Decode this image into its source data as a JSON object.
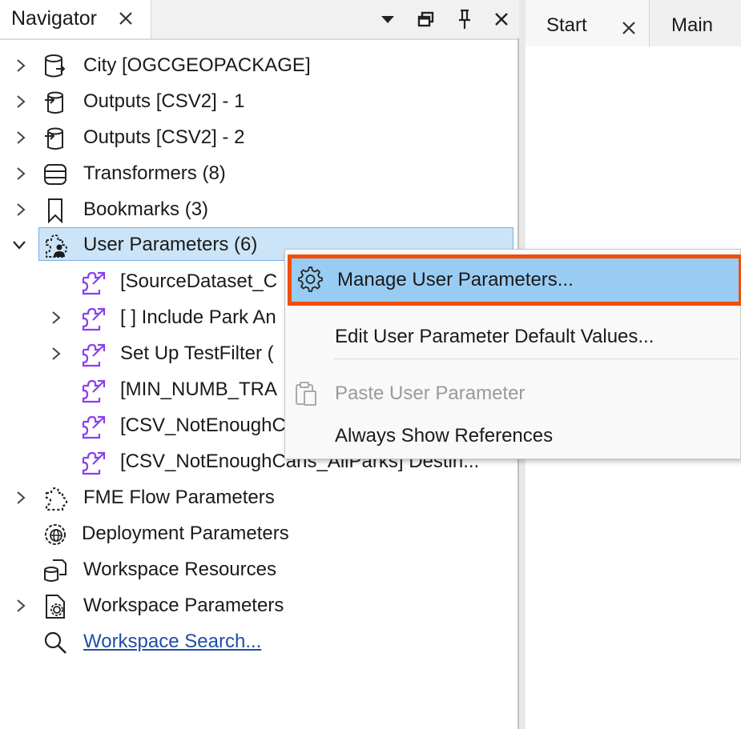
{
  "navigator": {
    "title": "Navigator",
    "tree": [
      {
        "label": "City [OGCGEOPACKAGE]",
        "icon": "database-reader-icon",
        "expanded": false
      },
      {
        "label": "Outputs [CSV2] - 1",
        "icon": "writer-icon",
        "expanded": false
      },
      {
        "label": "Outputs [CSV2] - 2",
        "icon": "writer-icon",
        "expanded": false
      },
      {
        "label": "Transformers (8)",
        "icon": "transformers-icon",
        "expanded": false
      },
      {
        "label": "Bookmarks (3)",
        "icon": "bookmark-icon",
        "expanded": false
      },
      {
        "label": "User Parameters (6)",
        "icon": "user-parameters-icon",
        "expanded": true,
        "selected": true
      },
      {
        "label": "[SourceDataset_C",
        "icon": "parameter-icon",
        "child": true
      },
      {
        "label": "[ ] Include Park An",
        "icon": "parameter-icon",
        "child": true,
        "expandable": true
      },
      {
        "label": "Set Up TestFilter (",
        "icon": "parameter-icon",
        "child": true,
        "expandable": true
      },
      {
        "label": "[MIN_NUMB_TRA",
        "icon": "parameter-icon",
        "child": true
      },
      {
        "label": "[CSV_NotEnoughC",
        "icon": "parameter-icon",
        "child": true
      },
      {
        "label": "[CSV_NotEnoughCans_AllParks] Destin...",
        "icon": "parameter-icon",
        "child": true
      },
      {
        "label": "FME Flow Parameters",
        "icon": "flow-parameters-icon",
        "expanded": false
      },
      {
        "label": "Deployment Parameters",
        "icon": "deployment-parameters-icon"
      },
      {
        "label": "Workspace Resources",
        "icon": "workspace-resources-icon"
      },
      {
        "label": "Workspace Parameters",
        "icon": "workspace-parameters-icon",
        "expanded": false
      },
      {
        "label": "Workspace Search...",
        "icon": "search-icon",
        "link": true
      }
    ]
  },
  "right_tabs": {
    "start": "Start",
    "main": "Main"
  },
  "context_menu": {
    "manage": "Manage User Parameters...",
    "edit_defaults": "Edit User Parameter Default Values...",
    "paste": "Paste User Parameter",
    "always_show": "Always Show References"
  },
  "colors": {
    "selection": "#cce4f7",
    "menu_highlight": "#99ccf3",
    "highlight_outline": "#f04e0c",
    "parameter_icon": "#8a3ff0",
    "link": "#1f4ea8"
  }
}
